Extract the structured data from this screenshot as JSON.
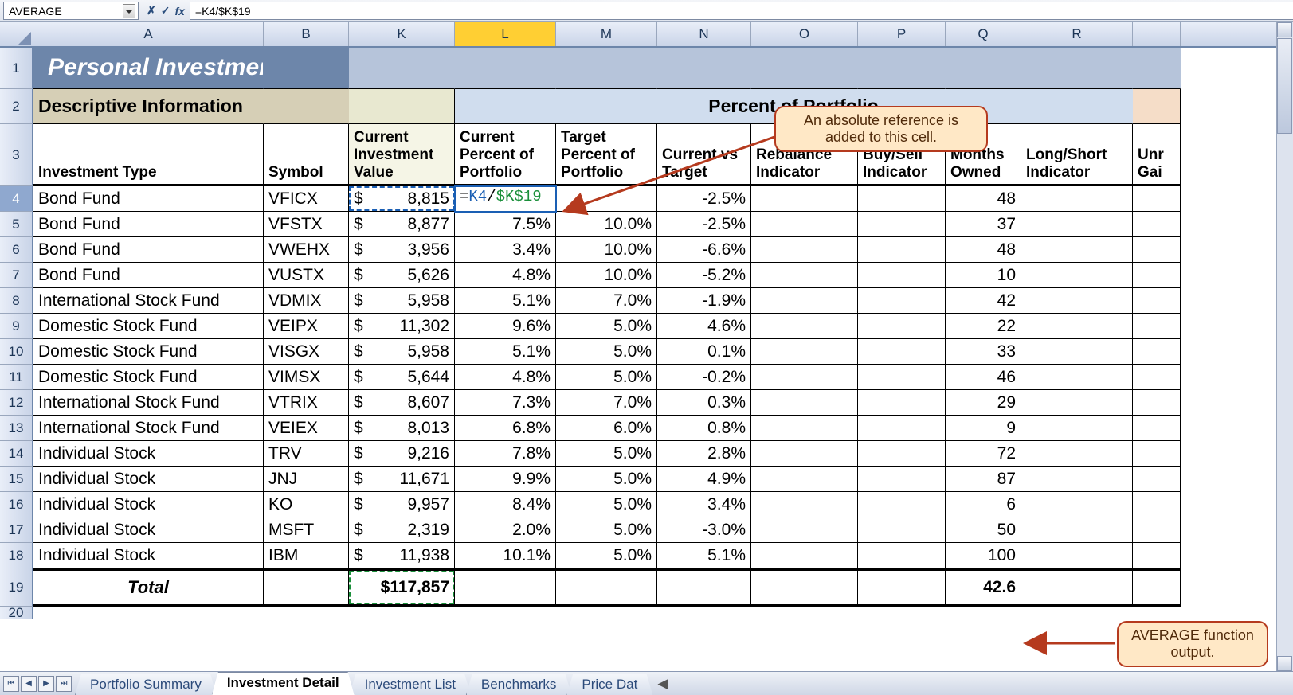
{
  "formula_bar": {
    "name_box": "AVERAGE",
    "cancel_glyph": "✗",
    "enter_glyph": "✓",
    "fx_glyph": "fx",
    "formula": "=K4/$K$19"
  },
  "column_headers": [
    "A",
    "B",
    "K",
    "L",
    "M",
    "N",
    "O",
    "P",
    "Q",
    "R"
  ],
  "selected_column": "L",
  "row_numbers": [
    "1",
    "2",
    "3",
    "4",
    "5",
    "6",
    "7",
    "8",
    "9",
    "10",
    "11",
    "12",
    "13",
    "14",
    "15",
    "16",
    "17",
    "18",
    "19",
    "20"
  ],
  "selected_row": "4",
  "title": "Personal Investment",
  "section_descriptive": "Descriptive Information",
  "section_portfolio": "Percent of Portfolio",
  "col_labels": {
    "investment_type": "Investment Type",
    "symbol": "Symbol",
    "current_value": "Current Investment Value",
    "current_pct": "Current Percent of Portfolio",
    "target_pct": "Target Percent of Portfolio",
    "cur_vs_tgt": "Current vs Target",
    "rebalance": "Rebalance Indicator",
    "buy_sell": "Buy/Sell Indicator",
    "months_owned": "Months Owned",
    "long_short": "Long/Short Indicator",
    "unr_gai": "Unr Gai"
  },
  "editing_cell": {
    "eq": "=",
    "ref1": "K4",
    "slash": "/",
    "ref2": "$K$19"
  },
  "rows": [
    {
      "type": "Bond Fund",
      "sym": "VFICX",
      "val": "8,815",
      "cur": "",
      "tgt": "",
      "cvt": "-2.5%",
      "months": "48"
    },
    {
      "type": "Bond Fund",
      "sym": "VFSTX",
      "val": "8,877",
      "cur": "7.5%",
      "tgt": "10.0%",
      "cvt": "-2.5%",
      "months": "37"
    },
    {
      "type": "Bond Fund",
      "sym": "VWEHX",
      "val": "3,956",
      "cur": "3.4%",
      "tgt": "10.0%",
      "cvt": "-6.6%",
      "months": "48"
    },
    {
      "type": "Bond Fund",
      "sym": "VUSTX",
      "val": "5,626",
      "cur": "4.8%",
      "tgt": "10.0%",
      "cvt": "-5.2%",
      "months": "10"
    },
    {
      "type": "International Stock Fund",
      "sym": "VDMIX",
      "val": "5,958",
      "cur": "5.1%",
      "tgt": "7.0%",
      "cvt": "-1.9%",
      "months": "42"
    },
    {
      "type": "Domestic Stock Fund",
      "sym": "VEIPX",
      "val": "11,302",
      "cur": "9.6%",
      "tgt": "5.0%",
      "cvt": "4.6%",
      "months": "22"
    },
    {
      "type": "Domestic Stock Fund",
      "sym": "VISGX",
      "val": "5,958",
      "cur": "5.1%",
      "tgt": "5.0%",
      "cvt": "0.1%",
      "months": "33"
    },
    {
      "type": "Domestic Stock Fund",
      "sym": "VIMSX",
      "val": "5,644",
      "cur": "4.8%",
      "tgt": "5.0%",
      "cvt": "-0.2%",
      "months": "46"
    },
    {
      "type": "International Stock Fund",
      "sym": "VTRIX",
      "val": "8,607",
      "cur": "7.3%",
      "tgt": "7.0%",
      "cvt": "0.3%",
      "months": "29"
    },
    {
      "type": "International Stock Fund",
      "sym": "VEIEX",
      "val": "8,013",
      "cur": "6.8%",
      "tgt": "6.0%",
      "cvt": "0.8%",
      "months": "9"
    },
    {
      "type": "Individual Stock",
      "sym": "TRV",
      "val": "9,216",
      "cur": "7.8%",
      "tgt": "5.0%",
      "cvt": "2.8%",
      "months": "72"
    },
    {
      "type": "Individual Stock",
      "sym": "JNJ",
      "val": "11,671",
      "cur": "9.9%",
      "tgt": "5.0%",
      "cvt": "4.9%",
      "months": "87"
    },
    {
      "type": "Individual Stock",
      "sym": "KO",
      "val": "9,957",
      "cur": "8.4%",
      "tgt": "5.0%",
      "cvt": "3.4%",
      "months": "6"
    },
    {
      "type": "Individual Stock",
      "sym": "MSFT",
      "val": "2,319",
      "cur": "2.0%",
      "tgt": "5.0%",
      "cvt": "-3.0%",
      "months": "50"
    },
    {
      "type": "Individual Stock",
      "sym": "IBM",
      "val": "11,938",
      "cur": "10.1%",
      "tgt": "5.0%",
      "cvt": "5.1%",
      "months": "100"
    }
  ],
  "total": {
    "label": "Total",
    "val": "$117,857",
    "months": "42.6"
  },
  "callout1": "An absolute reference is added to this cell.",
  "callout2": "AVERAGE function output.",
  "tabs": {
    "items": [
      "Portfolio Summary",
      "Investment Detail",
      "Investment List",
      "Benchmarks",
      "Price Dat"
    ],
    "active": 1
  },
  "dollar_sign": "$"
}
